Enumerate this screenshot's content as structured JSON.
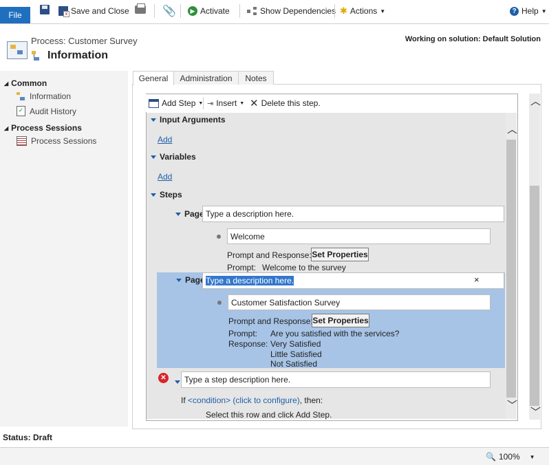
{
  "ribbon": {
    "file": "File",
    "save_and_close": "Save and Close",
    "activate": "Activate",
    "show_dependencies": "Show Dependencies",
    "actions": "Actions",
    "help": "Help"
  },
  "header": {
    "entity": "Process: Customer Survey",
    "title": "Information",
    "solution": "Working on solution: Default Solution"
  },
  "sidebar": {
    "common": "Common",
    "information": "Information",
    "audit_history": "Audit History",
    "process_sessions_group": "Process Sessions",
    "process_sessions": "Process Sessions"
  },
  "tabs": [
    "General",
    "Administration",
    "Notes"
  ],
  "toolbar": {
    "add_step": "Add Step",
    "insert": "Insert",
    "delete": "Delete this step."
  },
  "sections": {
    "input_arguments": "Input Arguments",
    "variables": "Variables",
    "steps": "Steps",
    "add": "Add"
  },
  "page1": {
    "label": "Page:",
    "description": "Type a description here.",
    "step_name": "Welcome",
    "prompt_response": "Prompt and Response:",
    "set_properties": "Set Properties",
    "prompt_label": "Prompt:",
    "prompt_value": "Welcome to the survey"
  },
  "page2": {
    "label": "Page:",
    "description": "Type a description here.",
    "close": "×",
    "step_name": "Customer Satisfaction Survey",
    "prompt_response": "Prompt and Response:",
    "set_properties": "Set Properties",
    "prompt_label": "Prompt:",
    "prompt_value": "Are you satisfied with the services?",
    "response_label": "Response:",
    "responses": [
      "Very Satisfied",
      "Little Satisfied",
      "Not Satisfied"
    ]
  },
  "new_step": {
    "description": "Type a step description here.",
    "if": "If",
    "condition": "<condition> (click to configure)",
    "then": ", then:",
    "hint": "Select this row and click Add Step."
  },
  "status": "Status: Draft",
  "zoom": "100%",
  "colors": {
    "accent": "#1f6fbf",
    "selection": "#a7c4e6",
    "link": "#1f5fa8",
    "error": "#d9252a"
  }
}
